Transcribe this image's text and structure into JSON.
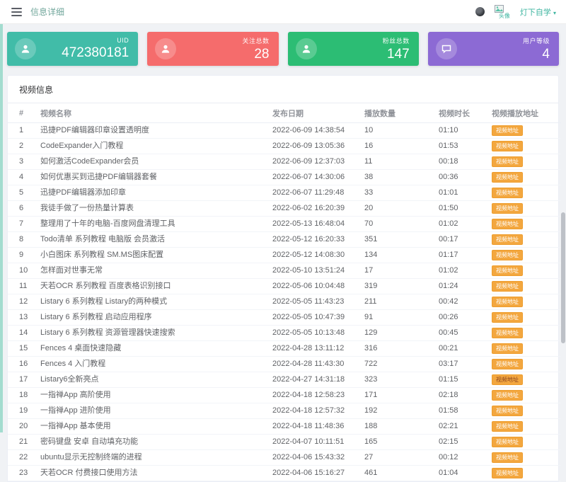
{
  "header": {
    "title": "信息详细",
    "avatar_alt": "头像",
    "username": "灯下自学",
    "caret": "▾"
  },
  "cards": [
    {
      "label": "UID",
      "value": "472380181",
      "color": "#41bca8",
      "icon": "user-icon"
    },
    {
      "label": "关注总数",
      "value": "28",
      "color": "#f56c6c",
      "icon": "user-icon"
    },
    {
      "label": "粉丝总数",
      "value": "147",
      "color": "#2cbd74",
      "icon": "user-icon"
    },
    {
      "label": "用户等级",
      "value": "4",
      "color": "#8c6ad4",
      "icon": "comment-icon"
    }
  ],
  "section": {
    "title": "视频信息"
  },
  "table": {
    "columns": [
      "#",
      "视频名称",
      "发布日期",
      "播放数量",
      "视频时长",
      "视频播放地址"
    ],
    "button_label": "视频地址",
    "rows": [
      {
        "index": "1",
        "name": "迅捷PDF编辑器印章设置透明度",
        "date": "2022-06-09 14:38:54",
        "plays": "10",
        "duration": "01:10"
      },
      {
        "index": "2",
        "name": "CodeExpander入门教程",
        "date": "2022-06-09 13:05:36",
        "plays": "16",
        "duration": "01:53"
      },
      {
        "index": "3",
        "name": "如何激活CodeExpander会员",
        "date": "2022-06-09 12:37:03",
        "plays": "11",
        "duration": "00:18"
      },
      {
        "index": "4",
        "name": "如何优惠买到迅捷PDF编辑器套餐",
        "date": "2022-06-07 14:30:06",
        "plays": "38",
        "duration": "00:36"
      },
      {
        "index": "5",
        "name": "迅捷PDF编辑器添加印章",
        "date": "2022-06-07 11:29:48",
        "plays": "33",
        "duration": "01:01"
      },
      {
        "index": "6",
        "name": "我徒手做了一份热量计算表",
        "date": "2022-06-02 16:20:39",
        "plays": "20",
        "duration": "01:50"
      },
      {
        "index": "7",
        "name": "整理用了十年的电脑-百度网盘清理工具",
        "date": "2022-05-13 16:48:04",
        "plays": "70",
        "duration": "01:02"
      },
      {
        "index": "8",
        "name": "Todo清单 系列教程 电脑版 会员激活",
        "date": "2022-05-12 16:20:33",
        "plays": "351",
        "duration": "00:17"
      },
      {
        "index": "9",
        "name": "小白图床 系列教程 SM.MS图床配置",
        "date": "2022-05-12 14:08:30",
        "plays": "134",
        "duration": "01:17"
      },
      {
        "index": "10",
        "name": "怎样面对世事无常",
        "date": "2022-05-10 13:51:24",
        "plays": "17",
        "duration": "01:02"
      },
      {
        "index": "11",
        "name": "天若OCR 系列教程 百度表格识别接口",
        "date": "2022-05-06 10:04:48",
        "plays": "319",
        "duration": "01:24"
      },
      {
        "index": "12",
        "name": "Listary 6 系列教程 Listary的两种模式",
        "date": "2022-05-05 11:43:23",
        "plays": "211",
        "duration": "00:42"
      },
      {
        "index": "13",
        "name": "Listary 6 系列教程 启动应用程序",
        "date": "2022-05-05 10:47:39",
        "plays": "91",
        "duration": "00:26"
      },
      {
        "index": "14",
        "name": "Listary 6 系列教程 资源管理器快速搜索",
        "date": "2022-05-05 10:13:48",
        "plays": "129",
        "duration": "00:45"
      },
      {
        "index": "15",
        "name": "Fences 4 桌面快速隐藏",
        "date": "2022-04-28 13:11:12",
        "plays": "316",
        "duration": "00:21"
      },
      {
        "index": "16",
        "name": "Fences 4 入门教程",
        "date": "2022-04-28 11:43:30",
        "plays": "722",
        "duration": "03:17"
      },
      {
        "index": "17",
        "name": "Listary6全新亮点",
        "date": "2022-04-27 14:31:18",
        "plays": "323",
        "duration": "01:15",
        "visited": true
      },
      {
        "index": "18",
        "name": "一指禅App 高阶使用",
        "date": "2022-04-18 12:58:23",
        "plays": "171",
        "duration": "02:18"
      },
      {
        "index": "19",
        "name": "一指禅App 进阶使用",
        "date": "2022-04-18 12:57:32",
        "plays": "192",
        "duration": "01:58"
      },
      {
        "index": "20",
        "name": "一指禅App 基本使用",
        "date": "2022-04-18 11:48:36",
        "plays": "188",
        "duration": "02:21"
      },
      {
        "index": "21",
        "name": "密码键盘 安卓 自动填充功能",
        "date": "2022-04-07 10:11:51",
        "plays": "165",
        "duration": "02:15"
      },
      {
        "index": "22",
        "name": "ubuntu显示无控制终端的进程",
        "date": "2022-04-06 15:43:32",
        "plays": "27",
        "duration": "00:12"
      },
      {
        "index": "23",
        "name": "天若OCR 付费接口使用方法",
        "date": "2022-04-06 15:16:27",
        "plays": "461",
        "duration": "01:04"
      }
    ]
  },
  "colors": {
    "button_bg": "#f3a73f",
    "accent_teal": "#3eb5a0",
    "side_strip": "#a3dccf"
  }
}
